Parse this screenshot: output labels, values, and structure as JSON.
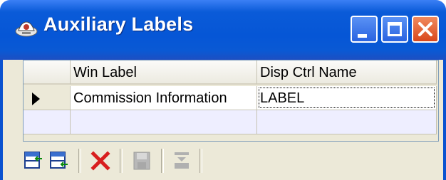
{
  "window": {
    "title": "Auxiliary Labels",
    "title_icon": "app-icon",
    "controls": [
      "minimize-icon",
      "maximize-icon",
      "close-icon"
    ]
  },
  "grid": {
    "columns": [
      "Win Label",
      "Disp Ctrl Name"
    ],
    "rows": [
      {
        "win_label": "Commission Information",
        "disp_ctrl_name": "LABEL",
        "current": true
      }
    ]
  },
  "toolbar": {
    "buttons": [
      {
        "name": "insert-before-icon",
        "enabled": true
      },
      {
        "name": "insert-after-icon",
        "enabled": true
      },
      {
        "name": "delete-icon",
        "enabled": true,
        "color": "#d81e1e"
      },
      {
        "name": "save-icon",
        "enabled": false
      },
      {
        "name": "move-down-icon",
        "enabled": false
      }
    ]
  },
  "colors": {
    "titlebar": "#0656d6",
    "close_button": "#d9471c",
    "new_row": "#eeeeff"
  }
}
